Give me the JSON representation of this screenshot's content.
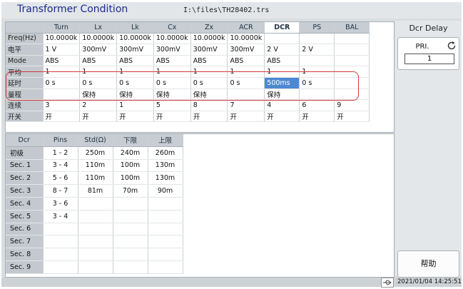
{
  "window": {
    "title": "Transformer Condition",
    "file_path": "I:\\files\\TH28402.trs"
  },
  "param_table": {
    "columns": [
      "Turn",
      "Lx",
      "Lk",
      "Cx",
      "Zx",
      "ACR",
      "DCR",
      "PS",
      "BAL"
    ],
    "active_column": "DCR",
    "rows": [
      {
        "label": "Freq(Hz)",
        "cells": [
          "10.0000k",
          "10.0000k",
          "10.0000k",
          "10.0000k",
          "10.0000k",
          "10.0000k",
          "",
          "",
          ""
        ]
      },
      {
        "label": "电平",
        "cells": [
          "1 V",
          "300mV",
          "300mV",
          "300mV",
          "300mV",
          "300mV",
          "2 V",
          "2 V",
          ""
        ]
      },
      {
        "label": "Mode",
        "cells": [
          "ABS",
          "ABS",
          "ABS",
          "ABS",
          "ABS",
          "ABS",
          "ABS",
          "",
          ""
        ]
      },
      {
        "label": "平均",
        "cells": [
          "1",
          "1",
          "1",
          "1",
          "1",
          "1",
          "1",
          "1",
          ""
        ]
      },
      {
        "label": "延时",
        "cells": [
          "0 s",
          "0 s",
          "0 s",
          "0 s",
          "0 s",
          "0 s",
          "500ms",
          "0 s",
          ""
        ]
      },
      {
        "label": "量程",
        "cells": [
          "",
          "保持",
          "保持",
          "保持",
          "保持",
          "",
          "保持",
          "",
          ""
        ]
      },
      {
        "label": "连续",
        "cells": [
          "3",
          "2",
          "1",
          "5",
          "8",
          "7",
          "4",
          "6",
          "9"
        ]
      },
      {
        "label": "开关",
        "cells": [
          "开",
          "开",
          "开",
          "开",
          "开",
          "开",
          "开",
          "开",
          "开"
        ]
      }
    ],
    "selected_cell": {
      "row": "延时",
      "column": "DCR"
    }
  },
  "dcr_table": {
    "columns": [
      "Dcr",
      "Pins",
      "Std(Ω)",
      "下限",
      "上限"
    ],
    "rows": [
      {
        "label": "初级",
        "pins": "1 - 2",
        "std": "250m",
        "low": "240m",
        "high": "260m"
      },
      {
        "label": "Sec. 1",
        "pins": "3 - 4",
        "std": "110m",
        "low": "100m",
        "high": "130m"
      },
      {
        "label": "Sec. 2",
        "pins": "5 - 6",
        "std": "110m",
        "low": "100m",
        "high": "130m"
      },
      {
        "label": "Sec. 3",
        "pins": "8 - 7",
        "std": "81m",
        "low": "70m",
        "high": "90m"
      },
      {
        "label": "Sec. 4",
        "pins": "3 - 6",
        "std": "",
        "low": "",
        "high": ""
      },
      {
        "label": "Sec. 5",
        "pins": "3 - 4",
        "std": "",
        "low": "",
        "high": ""
      },
      {
        "label": "Sec. 6",
        "pins": "",
        "std": "",
        "low": "",
        "high": ""
      },
      {
        "label": "Sec. 7",
        "pins": "",
        "std": "",
        "low": "",
        "high": ""
      },
      {
        "label": "Sec. 8",
        "pins": "",
        "std": "",
        "low": "",
        "high": ""
      },
      {
        "label": "Sec. 9",
        "pins": "",
        "std": "",
        "low": "",
        "high": ""
      }
    ]
  },
  "side_panel": {
    "title": "Dcr Delay",
    "selector_label": "PRI.",
    "selector_value": "1",
    "refresh_icon": "refresh-icon",
    "help_label": "帮助"
  },
  "status_bar": {
    "usb_icon": "usb-icon",
    "datetime": "2021/01/04 14:25:51"
  },
  "colors": {
    "title_text": "#1b2c8e",
    "selection": "#4d88d3",
    "highlight_box": "#d0393c",
    "header_bg": "#c7cdd2"
  }
}
